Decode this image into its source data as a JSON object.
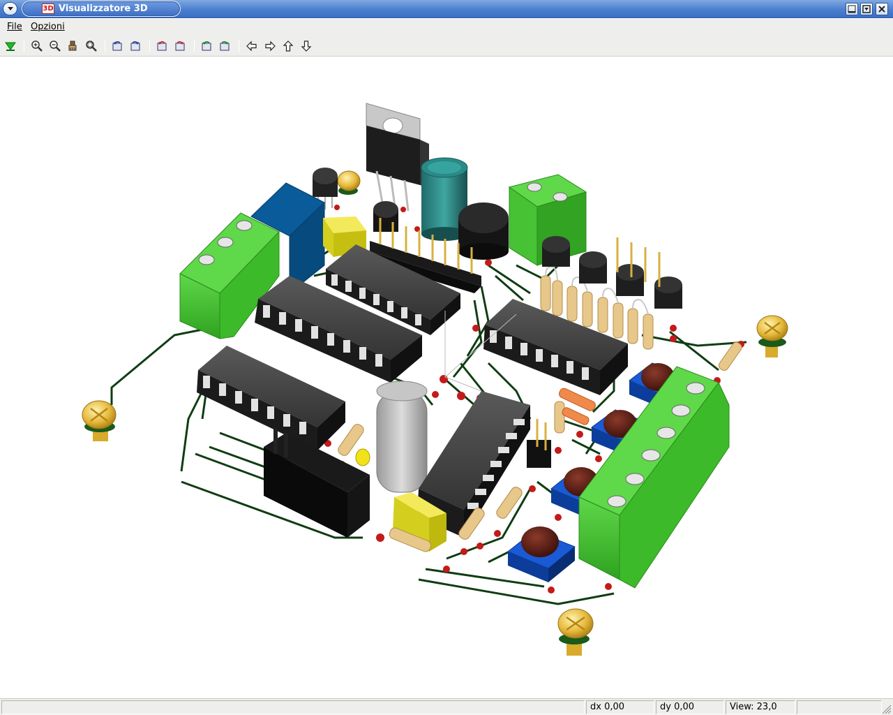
{
  "window": {
    "title": "Visualizzatore 3D",
    "app_icon_text": "3D"
  },
  "menu": {
    "file": "File",
    "options": "Opzioni"
  },
  "toolbar": {
    "buttons": [
      "reload-icon",
      "zoom-in-icon",
      "zoom-out-icon",
      "redraw-icon",
      "zoom-fit-icon",
      "rotate-x-neg-icon",
      "rotate-x-pos-icon",
      "rotate-y-neg-icon",
      "rotate-y-pos-icon",
      "rotate-z-neg-icon",
      "rotate-z-pos-icon",
      "pan-left-icon",
      "pan-right-icon",
      "pan-up-icon",
      "pan-down-icon"
    ]
  },
  "status": {
    "main": "",
    "dx": "dx 0,00",
    "dy": "dy 0,00",
    "view": "View: 23,0",
    "extra": ""
  },
  "colors": {
    "board_trace": "#0f3d12",
    "terminal_green": "#3cbf2a",
    "ic_body": "#2b2b2b",
    "pad_red": "#c41a1a",
    "resistor_body": "#e8c78a",
    "button_blue": "#1a5ad6"
  }
}
